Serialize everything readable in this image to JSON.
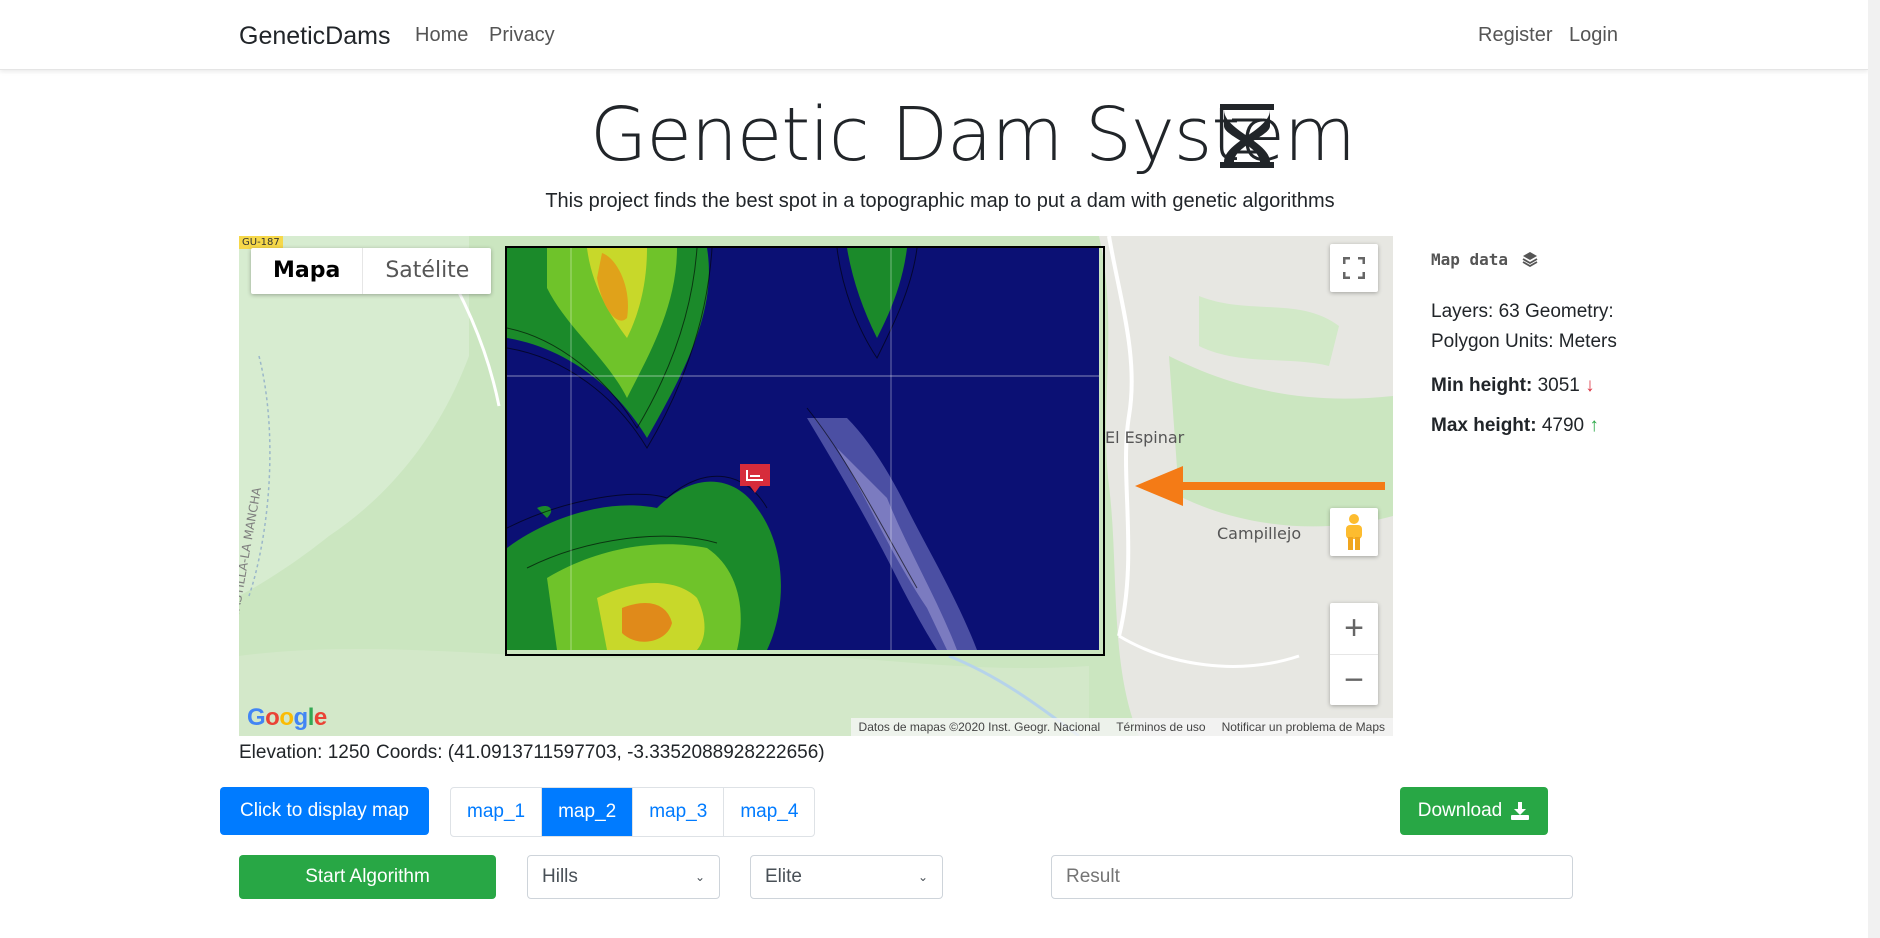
{
  "navbar": {
    "brand": "GeneticDams",
    "links": [
      "Home",
      "Privacy"
    ],
    "right_links": [
      "Register",
      "Login"
    ]
  },
  "header": {
    "title": "Genetic Dam System",
    "subtitle": "This project finds the best spot in a topographic map to put a dam with genetic algorithms"
  },
  "map": {
    "type_buttons": [
      "Mapa",
      "Satélite"
    ],
    "labels": {
      "el_espinar": "El Espinar",
      "campillejo": "Campillejo",
      "road_top": "GU-187",
      "mancha": "CASTILLA-LA MANCHA"
    },
    "google": "Google",
    "attribution": [
      "Datos de mapas ©2020 Inst. Geogr. Nacional",
      "Términos de uso",
      "Notificar un problema de Maps"
    ],
    "zoom_in": "+",
    "zoom_out": "−"
  },
  "info": {
    "title": "Map data",
    "layers_text": "Layers: 63 Geometry: Polygon Units: Meters",
    "min_label": "Min height:",
    "min_value": "3051",
    "max_label": "Max height:",
    "max_value": "4790",
    "down_color": "#dc3545",
    "up_color": "#28a745"
  },
  "elevation": {
    "elevation_text": "Elevation: 1250",
    "coords_text": "Coords: (41.0913711597703, -3.3352088928222656)"
  },
  "controls": {
    "display_map": "Click to display map",
    "maps": [
      "map_1",
      "map_2",
      "map_3",
      "map_4"
    ],
    "active_map": "map_2",
    "download": "Download",
    "start": "Start Algorithm",
    "terrain_select": "Hills",
    "selection_select": "Elite",
    "result_placeholder": "Result"
  }
}
